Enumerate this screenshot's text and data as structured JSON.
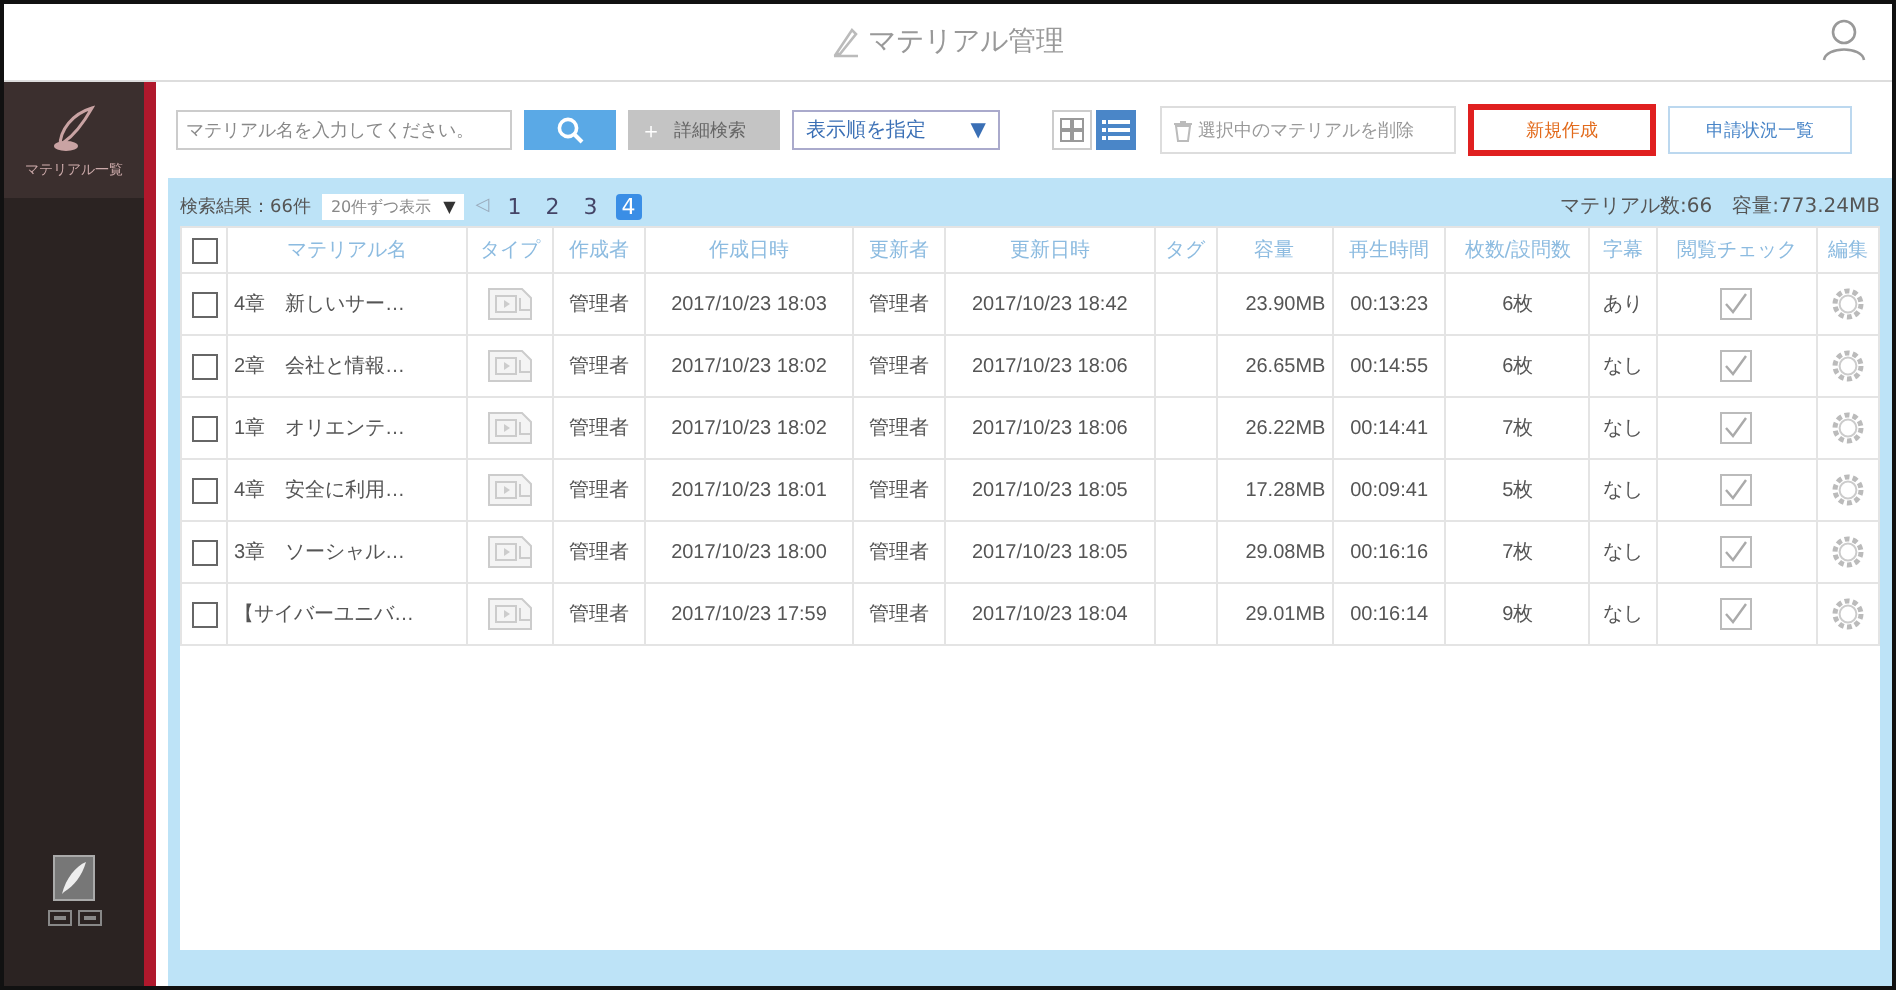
{
  "header": {
    "title": "マテリアル管理"
  },
  "sidebar": {
    "items": [
      {
        "label": "マテリアル一覧",
        "selected": true
      }
    ]
  },
  "toolbar": {
    "search": {
      "placeholder": "マテリアル名を入力してください。"
    },
    "advanced_search_icon": "＋",
    "advanced_search": "詳細検索",
    "sort": {
      "placeholder": "表示順を指定",
      "arrow": "▼"
    },
    "views": [
      {
        "kind": "grid",
        "selected": false
      },
      {
        "kind": "list",
        "selected": true
      }
    ],
    "delete_button": {
      "label": "選択中のマテリアルを削除",
      "disabled": true
    },
    "new_button": {
      "label": "新規作成",
      "highlighted": true
    },
    "status_button": "申請状況一覧"
  },
  "results": {
    "count": "検索結果：66件",
    "per_page": "20件ずつ表示",
    "per_page_arrow": "▼",
    "prev": "◁",
    "pages": [
      {
        "label": "1",
        "selected": false
      },
      {
        "label": "2",
        "selected": false
      },
      {
        "label": "3",
        "selected": false
      },
      {
        "label": "4",
        "selected": true
      }
    ],
    "summary": "マテリアル数:66　容量:773.24MB"
  },
  "table": {
    "select_all": {
      "checked": false
    },
    "columns": [
      "マテリアル名",
      "タイプ",
      "作成者",
      "作成日時",
      "更新者",
      "更新日時",
      "タグ",
      "容量",
      "再生時間",
      "枚数/設問数",
      "字幕",
      "閲覧チェック",
      "編集"
    ],
    "rows": [
      {
        "checked": false,
        "name": "4章　新しいサー…",
        "creator": "管理者",
        "created": "2017/10/23 18:03",
        "updater": "管理者",
        "updated": "2017/10/23 18:42",
        "size": "23.90MB",
        "duration": "00:13:23",
        "count": "6枚",
        "subtitles": "あり",
        "viewed": true
      },
      {
        "checked": false,
        "name": "2章　会社と情報…",
        "creator": "管理者",
        "created": "2017/10/23 18:02",
        "updater": "管理者",
        "updated": "2017/10/23 18:06",
        "size": "26.65MB",
        "duration": "00:14:55",
        "count": "6枚",
        "subtitles": "なし",
        "viewed": true
      },
      {
        "checked": false,
        "name": "1章　オリエンテ…",
        "creator": "管理者",
        "created": "2017/10/23 18:02",
        "updater": "管理者",
        "updated": "2017/10/23 18:06",
        "size": "26.22MB",
        "duration": "00:14:41",
        "count": "7枚",
        "subtitles": "なし",
        "viewed": true
      },
      {
        "checked": false,
        "name": "4章　安全に利用…",
        "creator": "管理者",
        "created": "2017/10/23 18:01",
        "updater": "管理者",
        "updated": "2017/10/23 18:05",
        "size": "17.28MB",
        "duration": "00:09:41",
        "count": "5枚",
        "subtitles": "なし",
        "viewed": true
      },
      {
        "checked": false,
        "name": "3章　ソーシャル…",
        "creator": "管理者",
        "created": "2017/10/23 18:00",
        "updater": "管理者",
        "updated": "2017/10/23 18:05",
        "size": "29.08MB",
        "duration": "00:16:16",
        "count": "7枚",
        "subtitles": "なし",
        "viewed": true
      },
      {
        "checked": false,
        "name": "【サイバーユニバ…",
        "creator": "管理者",
        "created": "2017/10/23 17:59",
        "updater": "管理者",
        "updated": "2017/10/23 18:04",
        "size": "29.01MB",
        "duration": "00:16:14",
        "count": "9枚",
        "subtitles": "なし",
        "viewed": true
      }
    ]
  }
}
